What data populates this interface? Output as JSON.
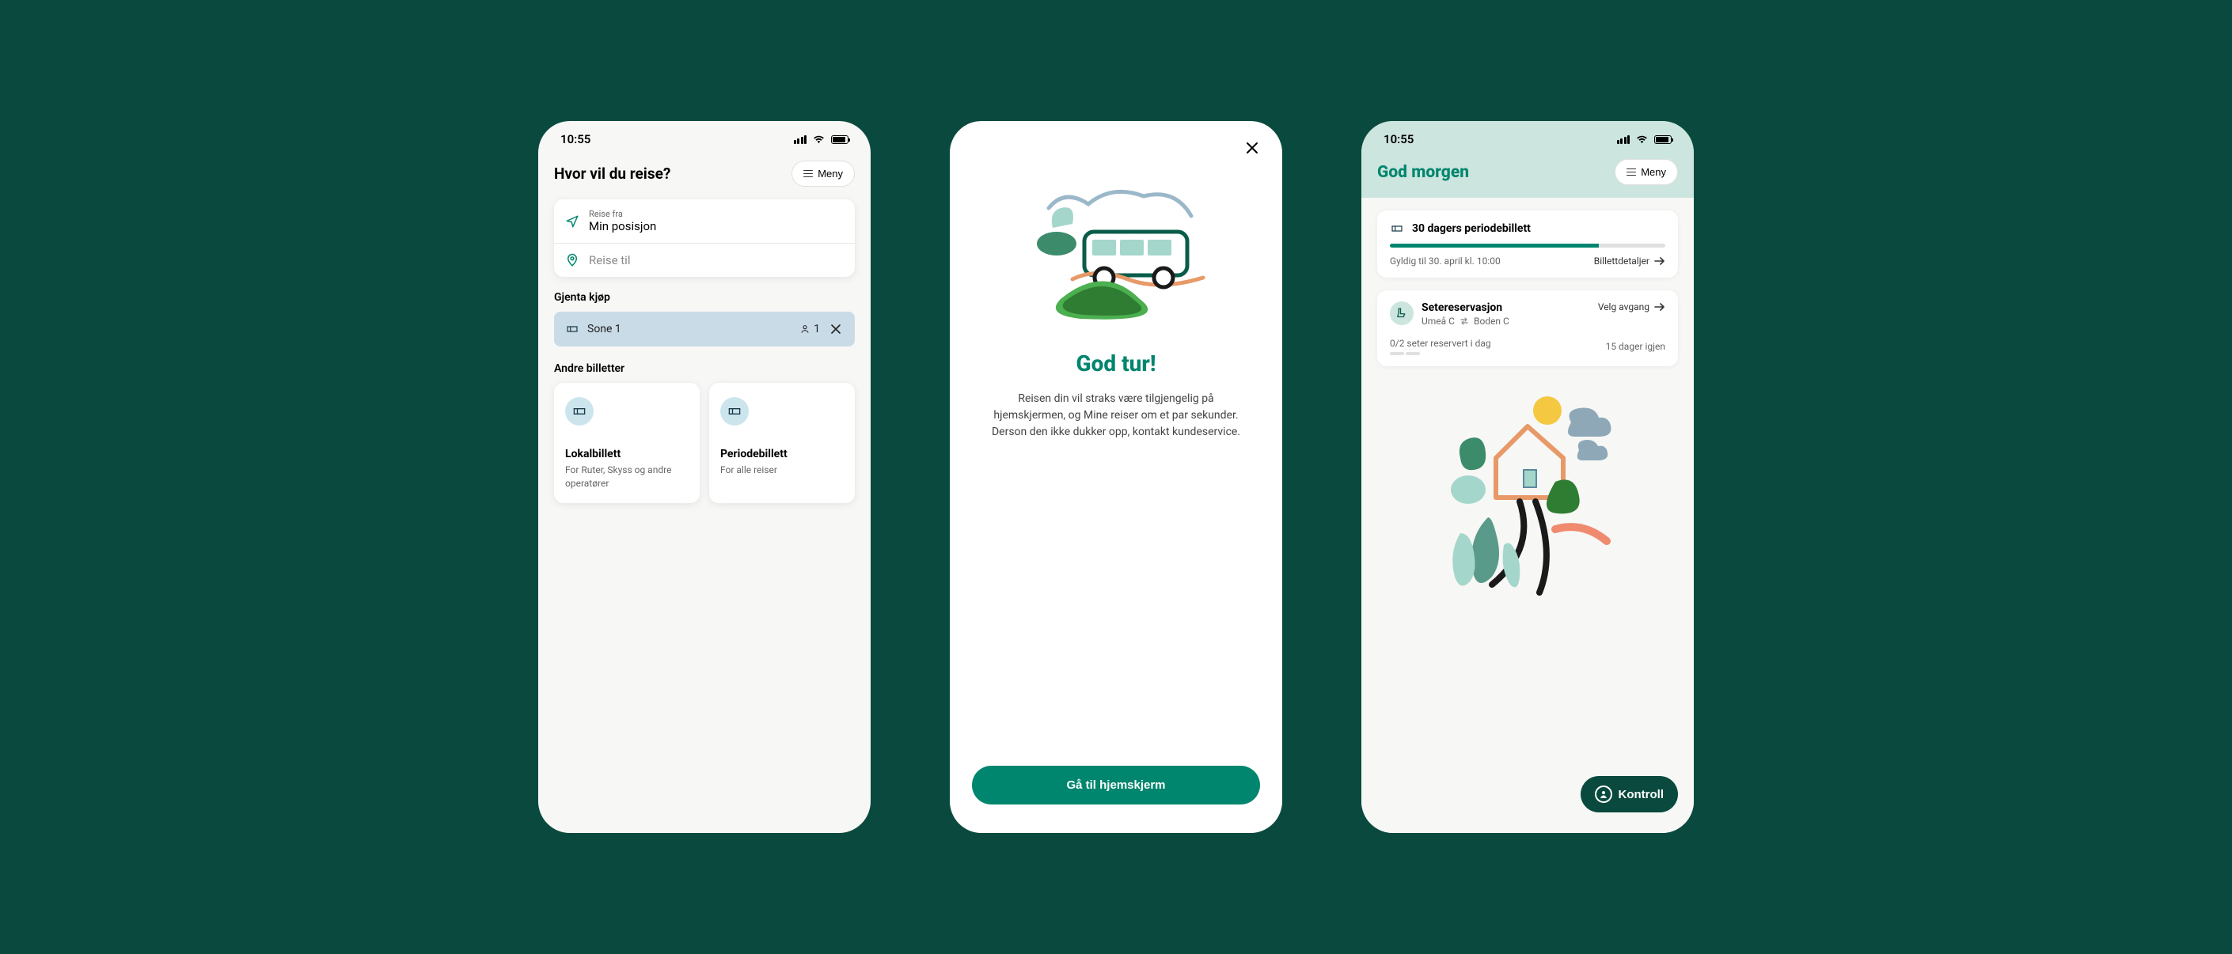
{
  "status": {
    "time": "10:55"
  },
  "menu_label": "Meny",
  "phone1": {
    "title": "Hvor vil du reise?",
    "from_label": "Reise fra",
    "from_value": "Min posisjon",
    "to_placeholder": "Reise til",
    "repeat_heading": "Gjenta kjøp",
    "repeat_zone": "Sone 1",
    "repeat_passengers": "1",
    "other_heading": "Andre billetter",
    "tickets": [
      {
        "title": "Lokalbillett",
        "sub": "For Ruter, Skyss og andre operatører"
      },
      {
        "title": "Periodebillett",
        "sub": "For alle reiser"
      }
    ]
  },
  "phone2": {
    "title": "God tur!",
    "body": "Reisen din vil straks være tilgjengelig på hjemskjermen, og Mine reiser om et par sekunder. Derson den ikke dukker opp, kontakt kundeservice.",
    "cta": "Gå til hjemskjerm"
  },
  "phone3": {
    "greeting": "God morgen",
    "period_ticket": {
      "title": "30 dagers periodebillett",
      "valid": "Gyldig til 30. april kl. 10:00",
      "link": "Billettdetaljer"
    },
    "reservation": {
      "title": "Setereservasjon",
      "from": "Umeå C",
      "to": "Boden C",
      "link": "Velg avgang",
      "status": "0/2 seter reservert i dag",
      "remaining": "15 dager igjen"
    },
    "kontroll": "Kontroll"
  }
}
